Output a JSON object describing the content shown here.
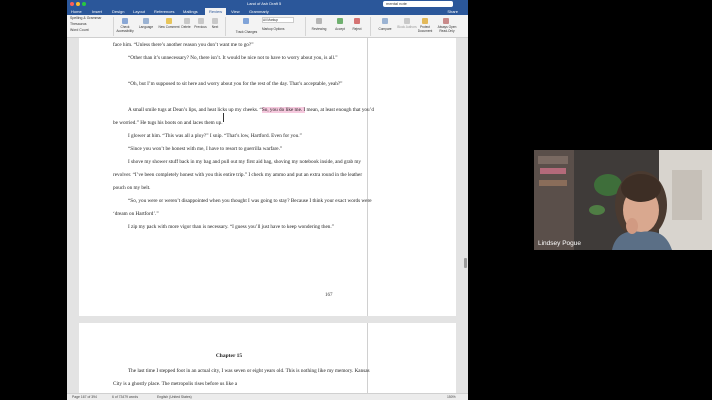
{
  "window": {
    "title": "Land of Ash Draft 5",
    "search_value": "mental note"
  },
  "tabs": [
    "Home",
    "Insert",
    "Design",
    "Layout",
    "References",
    "Mailings",
    "Review",
    "View",
    "Grammarly"
  ],
  "active_tab": "Review",
  "share_label": "Share",
  "ribbon": {
    "proofing": [
      "Spelling & Grammar",
      "Thesaurus",
      "Word Count"
    ],
    "items": [
      "Check Accessibility",
      "Language",
      "New Comment",
      "Delete",
      "Previous",
      "Next",
      "All Markup",
      "Track Changes",
      "Markup Options",
      "Reviewing",
      "Accept",
      "Reject",
      "Compare",
      "Block Authors",
      "Protect Document",
      "Always Open Read-Only"
    ]
  },
  "document": {
    "paragraphs": [
      "face him. “Unless there’s another reason you don’t want me to go?”",
      "“Other than it’s unnecessary? No, there isn’t. It would be nice not to have to worry about you, is all.”",
      "“Oh, but I’m supposed to sit here and worry about you for the rest of the day. That’s acceptable, yeah?”",
      "I glower at him. “This was all a ploy?” I snip. “That’s low, Hartford. Even for you.”",
      "“Since you won’t be honest with me, I have to resort to guerrilla warfare.”",
      "I shove my shower stuff back in my bag and pull out my first aid bag, shoving my notebook inside, and grab my revolver. “I’ve been completely honest with you this entire trip.” I check my ammo and put an extra round in the leather pouch on my belt.",
      "“So, you were or weren’t disappointed when you thought I was going to stay? Because I think your exact words were ‘dream on Hartford’.”",
      "I zip my pack with more vigor than is necessary. “I guess you’ll just have to keep wondering then.”"
    ],
    "smile_paragraph": {
      "before": "A small smile tugs at Dean’s lips, and heat licks up my cheeks. “",
      "highlight": "So, you do like me. I",
      "after": " mean, at least enough that you’d be worried.” He tugs his boots on and laces them up."
    },
    "page_number": "167",
    "chapter_heading": "Chapter 15",
    "page2_text": "The last time I stepped foot in an actual city, I was seven or eight years old. This is nothing like my memory. Kansas City is a ghostly place. The metropolis rises before us like a"
  },
  "status": {
    "page": "Page 167 of 394",
    "words": "6 of 73479 words",
    "language": "English (United States)",
    "zoom": "150%"
  },
  "video": {
    "participant": "Lindsey Pogue"
  },
  "colors": {
    "word_blue": "#2b579a",
    "highlight": "#f6c9de"
  }
}
